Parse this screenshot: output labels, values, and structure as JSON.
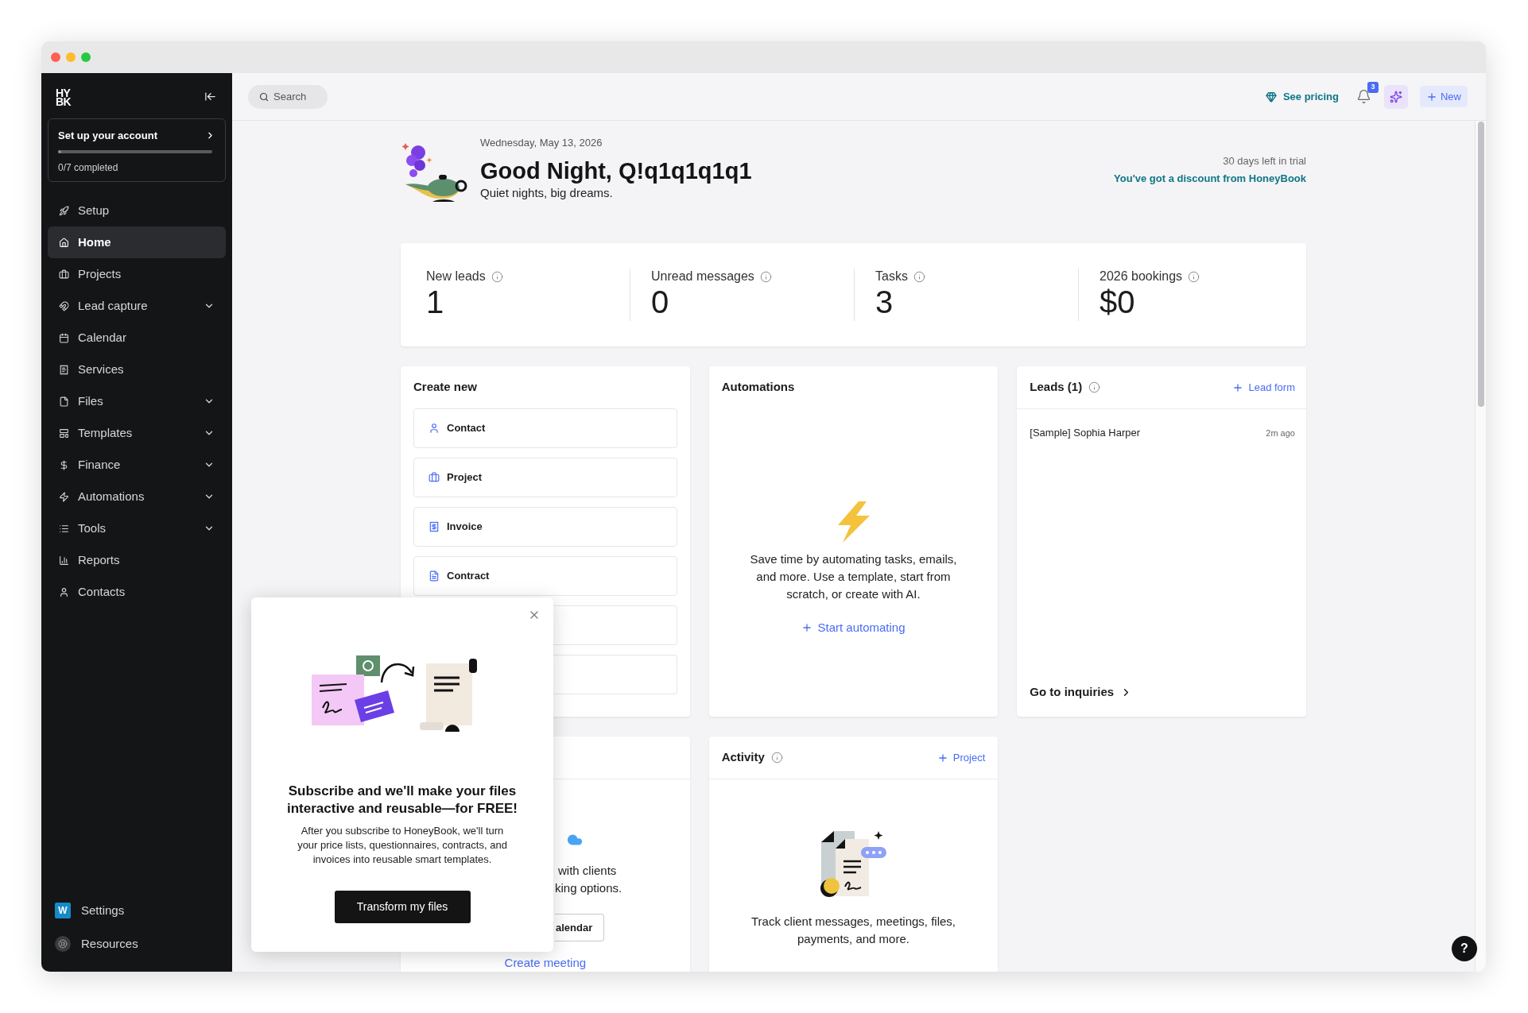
{
  "logo": {
    "lines": [
      "HY",
      "BK"
    ]
  },
  "sidebar": {
    "setup_card": {
      "title": "Set up your account",
      "progress": {
        "level": 0
      },
      "status": "0/7 completed"
    },
    "items": [
      {
        "label": "Setup",
        "selected": false,
        "has_submenu": false
      },
      {
        "label": "Home",
        "selected": true,
        "has_submenu": false
      },
      {
        "label": "Projects",
        "selected": false,
        "has_submenu": false
      },
      {
        "label": "Lead capture",
        "selected": false,
        "has_submenu": true
      },
      {
        "label": "Calendar",
        "selected": false,
        "has_submenu": false
      },
      {
        "label": "Services",
        "selected": false,
        "has_submenu": false
      },
      {
        "label": "Files",
        "selected": false,
        "has_submenu": true
      },
      {
        "label": "Templates",
        "selected": false,
        "has_submenu": true
      },
      {
        "label": "Finance",
        "selected": false,
        "has_submenu": true
      },
      {
        "label": "Automations",
        "selected": false,
        "has_submenu": true
      },
      {
        "label": "Tools",
        "selected": false,
        "has_submenu": true
      },
      {
        "label": "Reports",
        "selected": false,
        "has_submenu": false
      },
      {
        "label": "Contacts",
        "selected": false,
        "has_submenu": false
      }
    ],
    "footer_items": [
      {
        "kind": "workspace",
        "label": "Settings",
        "badge": "W"
      },
      {
        "kind": "resources",
        "label": "Resources"
      }
    ]
  },
  "top_bar": {
    "search": {
      "placeholder": "Search"
    },
    "pricing_link": "See pricing",
    "notifications": {
      "badge": "3"
    },
    "new_button": "New"
  },
  "header": {
    "date": "Wednesday, May 13, 2026",
    "greeting": "Good Night, Q!q1q1q1q1",
    "subtitle": "Quiet nights, big dreams.",
    "trial": "30 days left in trial",
    "discount_link": "You've got a discount from HoneyBook"
  },
  "stats": [
    {
      "label": "New leads",
      "value": "1"
    },
    {
      "label": "Unread messages",
      "value": "0"
    },
    {
      "label": "Tasks",
      "value": "3"
    },
    {
      "label": "2026 bookings",
      "value": "$0"
    }
  ],
  "create_new": {
    "title": "Create new",
    "items": [
      {
        "kind": "option",
        "label": "Contact"
      },
      {
        "kind": "option",
        "label": "Project"
      },
      {
        "kind": "option",
        "label": "Invoice"
      },
      {
        "kind": "option",
        "label": "Contract"
      },
      {
        "kind": "covered"
      },
      {
        "kind": "covered"
      }
    ]
  },
  "automations": {
    "title": "Automations",
    "description": "Save time by automating tasks, emails, and more. Use a template, start from scratch, or create with AI.",
    "action": "Start automating"
  },
  "leads": {
    "title": "Leads (1)",
    "action": "Lead form",
    "items": [
      {
        "name": "[Sample] Sophia Harper",
        "time": "2m ago"
      }
    ],
    "footer_link": "Go to inquiries"
  },
  "partial_card": {
    "text_fragments": [
      "with clients",
      "king options."
    ],
    "button": "alendar",
    "link": "Create meeting"
  },
  "activity": {
    "title": "Activity",
    "action": "Project",
    "description": "Track client messages, meetings, files, payments, and more."
  },
  "popup": {
    "title": "Subscribe and we'll make your files interactive and reusable—for FREE!",
    "body": "After you subscribe to HoneyBook, we'll turn your price lists, questionnaires, contracts, and invoices into reusable smart templates.",
    "button": "Transform my files"
  },
  "help_button": "?"
}
